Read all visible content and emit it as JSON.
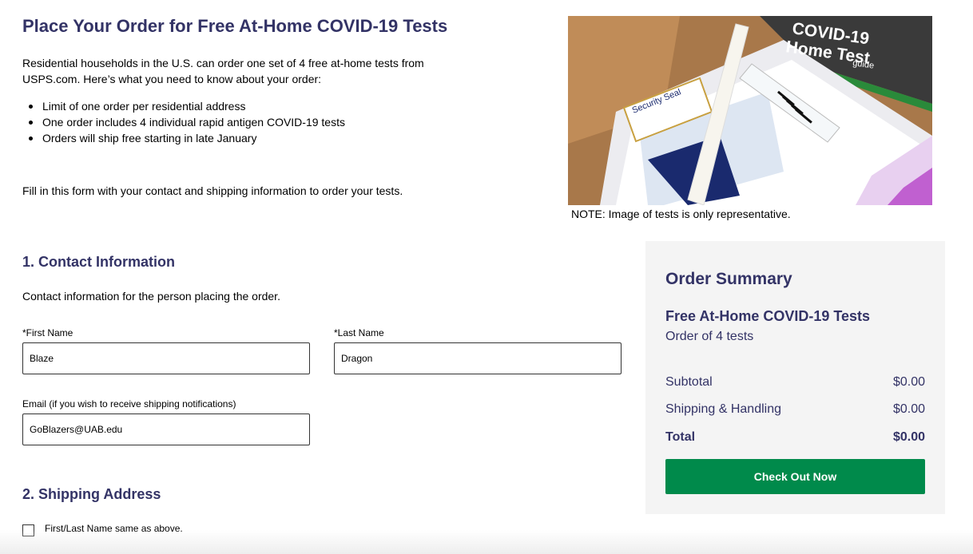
{
  "header": {
    "title": "Place Your Order for Free At-Home COVID-19 Tests",
    "intro": "Residential households in the U.S. can order one set of 4 free at-home tests from USPS.com. Here’s what you need to know about your order:",
    "bullets": [
      "Limit of one order per residential address",
      "One order includes 4 individual rapid antigen COVID-19 tests",
      "Orders will ship free starting in late January"
    ],
    "fill_in": "Fill in this form with your contact and shipping information to order your tests."
  },
  "hero": {
    "box_text_1": "COVID-19",
    "box_text_2": "Home Test",
    "box_text_3": "guide",
    "seal_text": "Security Seal",
    "note": "NOTE: Image of tests is only representative."
  },
  "contact": {
    "title": "1. Contact Information",
    "description": "Contact information for the person placing the order.",
    "first_name": {
      "label": "*First Name",
      "value": "Blaze"
    },
    "last_name": {
      "label": "*Last Name",
      "value": "Dragon"
    },
    "email": {
      "label": "Email (if you wish to receive shipping notifications)",
      "value": "GoBlazers@UAB.edu"
    }
  },
  "shipping": {
    "title": "2. Shipping Address",
    "same_name_label": "First/Last Name same as above.",
    "same_name_checked": false
  },
  "summary": {
    "title": "Order Summary",
    "product": "Free At-Home COVID-19 Tests",
    "quantity": "Order of 4 tests",
    "subtotal_label": "Subtotal",
    "subtotal_value": "$0.00",
    "shipping_label": "Shipping & Handling",
    "shipping_value": "$0.00",
    "total_label": "Total",
    "total_value": "$0.00",
    "checkout_label": "Check Out Now"
  },
  "colors": {
    "heading": "#333366",
    "button": "#008a4b",
    "summary_bg": "#f4f4f4"
  }
}
